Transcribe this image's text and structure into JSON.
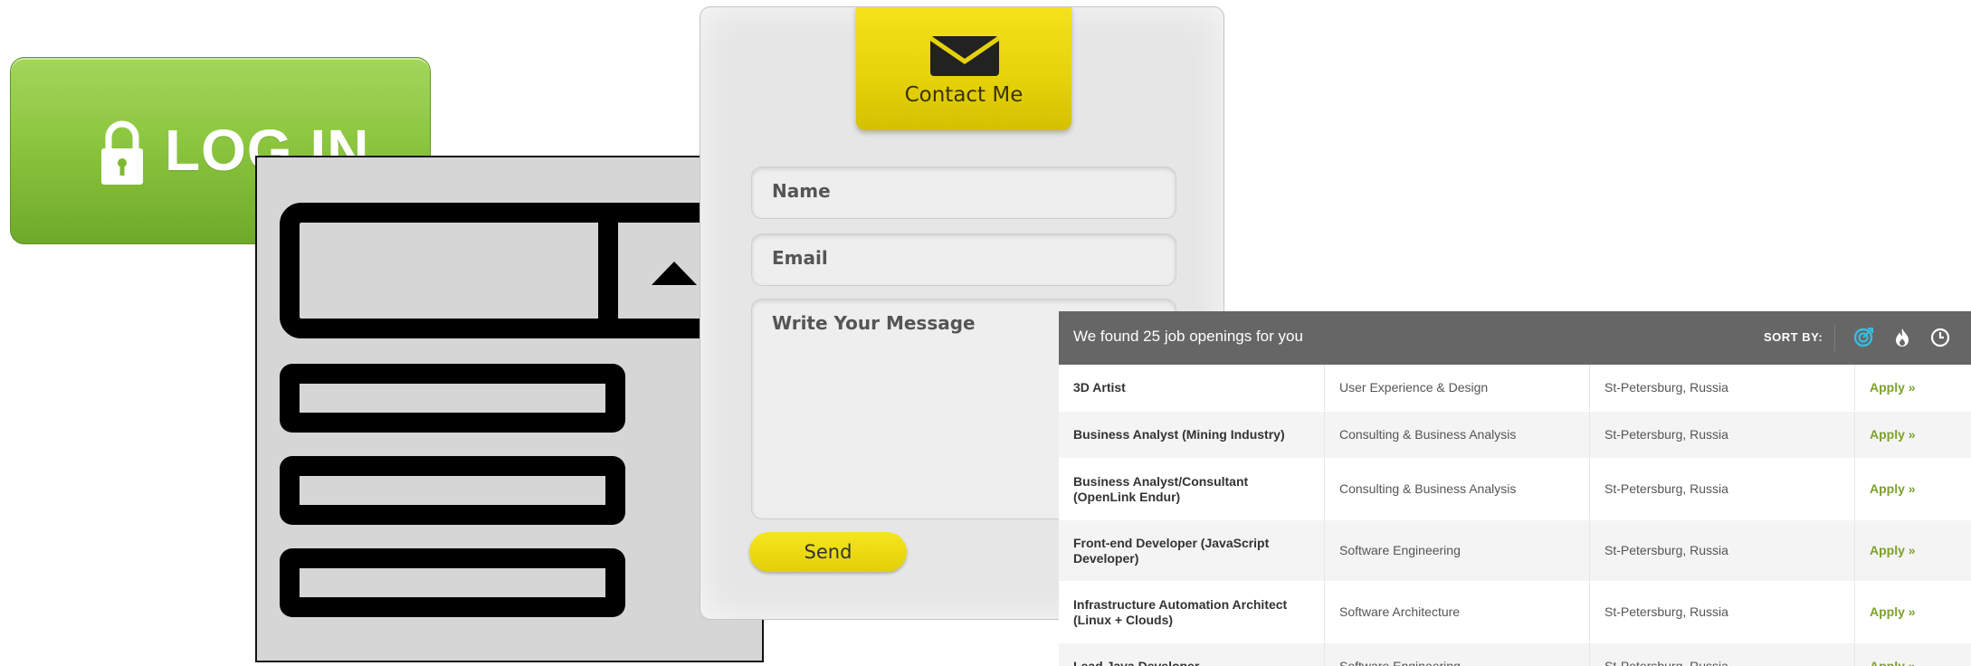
{
  "login_button": {
    "label": "LOG IN",
    "icon": "lock-icon"
  },
  "wireframe": {
    "icon": "dropdown-wireframe",
    "arrow_icon": "triangle-up-icon",
    "option_count": 3
  },
  "contact_form": {
    "tab_label": "Contact Me",
    "tab_icon": "envelope-icon",
    "name_placeholder": "Name",
    "email_placeholder": "Email",
    "message_placeholder": "Write Your Message",
    "send_label": "Send",
    "accent_color": "#e8d50c"
  },
  "jobs": {
    "title": "We found 25 job openings for you",
    "sort_label": "SORT BY:",
    "sort_icons": [
      "target-icon",
      "flame-icon",
      "clock-icon"
    ],
    "accent_color": "#7da12c",
    "rows": [
      {
        "title": "3D Artist",
        "category": "User Experience & Design",
        "location": "St-Petersburg,  Russia",
        "apply": "Apply »"
      },
      {
        "title": "Business Analyst (Mining Industry)",
        "category": "Consulting & Business Analysis",
        "location": "St-Petersburg,  Russia",
        "apply": "Apply »"
      },
      {
        "title": "Business Analyst/Consultant (OpenLink Endur)",
        "category": "Consulting & Business Analysis",
        "location": "St-Petersburg,  Russia",
        "apply": "Apply »"
      },
      {
        "title": "Front-end Developer (JavaScript Developer)",
        "category": "Software Engineering",
        "location": "St-Petersburg,  Russia",
        "apply": "Apply »"
      },
      {
        "title": "Infrastructure Automation Architect (Linux + Clouds)",
        "category": "Software Architecture",
        "location": "St-Petersburg,  Russia",
        "apply": "Apply »"
      },
      {
        "title": "Lead Java Developer",
        "category": "Software Engineering",
        "location": "St-Petersburg,  Russia",
        "apply": "Apply »"
      }
    ]
  }
}
